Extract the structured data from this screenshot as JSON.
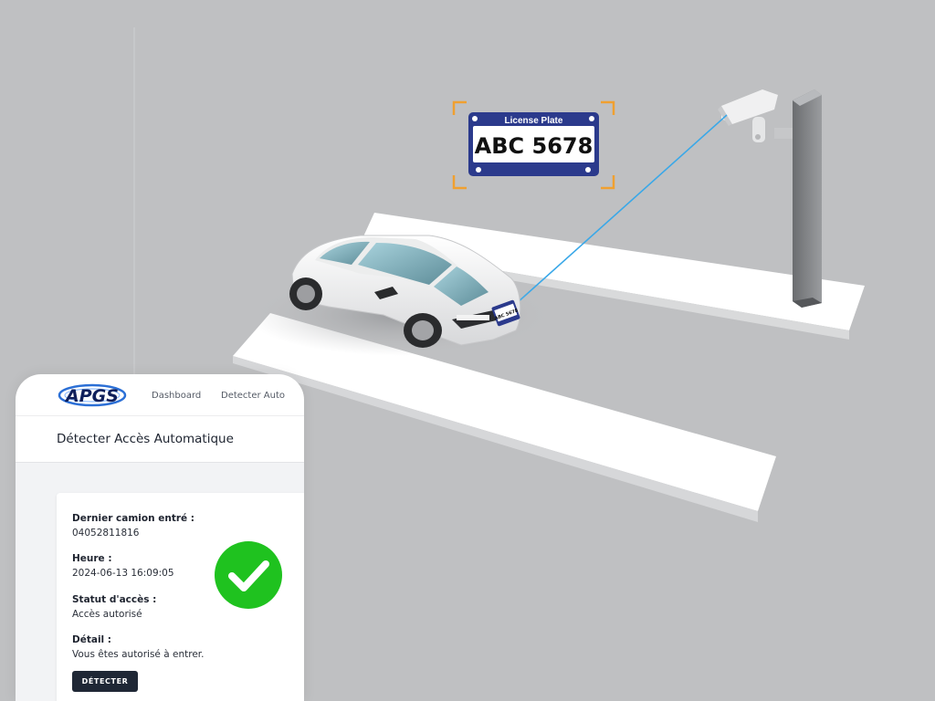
{
  "plate": {
    "header": "License Plate",
    "number": "ABC 5678",
    "car_plate_text": "ABC 5678"
  },
  "app": {
    "logo_text": "APGS"
  },
  "nav": {
    "dashboard": "Dashboard",
    "detect_auto": "Detecter Auto"
  },
  "page": {
    "title": "Détecter Accès Automatique"
  },
  "card": {
    "fields": [
      {
        "label": "Dernier camion entré :",
        "value": "04052811816"
      },
      {
        "label": "Heure :",
        "value": "2024-06-13 16:09:05"
      },
      {
        "label": "Statut d'accès :",
        "value": "Accès autorisé"
      },
      {
        "label": "Détail :",
        "value": "Vous êtes autorisé à entrer."
      }
    ],
    "button_label": "DÉTECTER",
    "status": "authorized",
    "status_icon": "checkmark-circle-icon"
  },
  "colors": {
    "background": "#bfc0c2",
    "plate_blue": "#2b3a8c",
    "bracket_orange": "#f0a030",
    "laser": "#3aa8e8",
    "success_green": "#1fc21f",
    "button_dark": "#1f2735"
  }
}
